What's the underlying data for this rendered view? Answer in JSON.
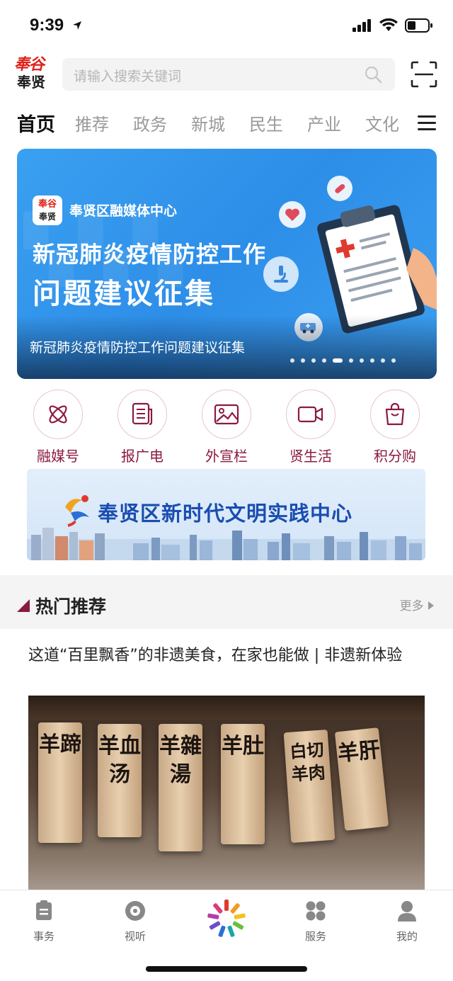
{
  "status_bar": {
    "time": "9:39"
  },
  "header": {
    "logo_top": "奉谷",
    "logo_bottom": "奉贤",
    "search_placeholder": "请输入搜索关键词"
  },
  "tabs": [
    "首页",
    "推荐",
    "政务",
    "新城",
    "民生",
    "产业",
    "文化"
  ],
  "active_tab": "首页",
  "banner": {
    "brand_logo_top": "奉谷",
    "brand_logo_bottom": "奉贤",
    "brand": "奉贤区融媒体中心",
    "headline_1": "新冠肺炎疫情防控工作",
    "headline_2": "问题建议征集",
    "caption": "新冠肺炎疫情防控工作问题建议征集",
    "slide_count": 10,
    "active_slide": 4
  },
  "quick_links": [
    {
      "label": "融媒号",
      "icon": "orbit-icon"
    },
    {
      "label": "报广电",
      "icon": "newspaper-icon"
    },
    {
      "label": "外宣栏",
      "icon": "image-icon"
    },
    {
      "label": "贤生活",
      "icon": "video-icon"
    },
    {
      "label": "积分购",
      "icon": "shopping-bag-icon"
    }
  ],
  "civic_banner": {
    "title": "奉贤区新时代文明实践中心"
  },
  "hot_section": {
    "title": "热门推荐",
    "more": "更多"
  },
  "article": {
    "title": "这道“百里飘香”的非遗美食，在家也能做 | 非遗新体验",
    "plank_texts": [
      "羊蹄",
      "羊血汤",
      "羊雜湯",
      "羊肚",
      "白切羊肉",
      "羊肝"
    ]
  },
  "bottom_nav": [
    {
      "label": "事务",
      "icon": "clipboard-icon"
    },
    {
      "label": "视听",
      "icon": "disc-icon"
    },
    {
      "label": "",
      "icon": "star-logo-icon"
    },
    {
      "label": "服务",
      "icon": "grid-icon"
    },
    {
      "label": "我的",
      "icon": "user-icon"
    }
  ],
  "colors": {
    "accent": "#8b1a40",
    "brand_red": "#e0211b",
    "banner_blue": "#2d8ee8",
    "civic_blue": "#1a4db0"
  }
}
